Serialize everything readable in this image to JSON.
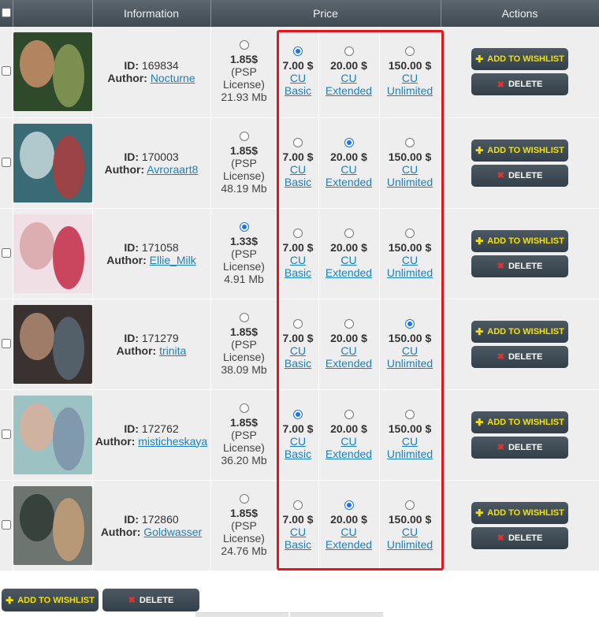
{
  "header": {
    "information": "Information",
    "price": "Price",
    "actions": "Actions"
  },
  "labels": {
    "id_prefix": "ID:",
    "author_prefix": "Author:",
    "psp_license": "(PSP License)",
    "cu": "CU",
    "basic": "Basic",
    "extended": "Extended",
    "unlimited": "Unlimited",
    "add_to_wishlist": "ADD TO WISHLIST",
    "delete": "DELETE"
  },
  "items": [
    {
      "id": "169834",
      "author": "Nocturne",
      "psp_price": "1.85$",
      "size": "21.93 Mb",
      "basic": "7.00 $",
      "extended": "20.00 $",
      "unlimited": "150.00 $",
      "selected": "basic",
      "thumb_colors": [
        "#2e4a2a",
        "#c98e6a",
        "#8fa05a"
      ]
    },
    {
      "id": "170003",
      "author": "Avroraart8",
      "psp_price": "1.85$",
      "size": "48.19 Mb",
      "basic": "7.00 $",
      "extended": "20.00 $",
      "unlimited": "150.00 $",
      "selected": "extended",
      "thumb_colors": [
        "#3a6b74",
        "#c7d8dc",
        "#b43a3a"
      ]
    },
    {
      "id": "171058",
      "author": "Ellie_Milk",
      "psp_price": "1.33$",
      "size": "4.91 Mb",
      "basic": "7.00 $",
      "extended": "20.00 $",
      "unlimited": "150.00 $",
      "selected": "psp",
      "thumb_colors": [
        "#f0dfe4",
        "#d9a6a8",
        "#c01f3c"
      ]
    },
    {
      "id": "171279",
      "author": "trinita",
      "psp_price": "1.85$",
      "size": "38.09 Mb",
      "basic": "7.00 $",
      "extended": "20.00 $",
      "unlimited": "150.00 $",
      "selected": "unlimited",
      "thumb_colors": [
        "#3a3230",
        "#b08a72",
        "#5a6a78"
      ]
    },
    {
      "id": "172762",
      "author": "misticheskaya",
      "psp_price": "1.85$",
      "size": "36.20 Mb",
      "basic": "7.00 $",
      "extended": "20.00 $",
      "unlimited": "150.00 $",
      "selected": "basic",
      "thumb_colors": [
        "#9cc2c4",
        "#d8b09a",
        "#7a8fa8"
      ]
    },
    {
      "id": "172860",
      "author": "Goldwasser",
      "psp_price": "1.85$",
      "size": "24.76 Mb",
      "basic": "7.00 $",
      "extended": "20.00 $",
      "unlimited": "150.00 $",
      "selected": "extended",
      "thumb_colors": [
        "#6e7470",
        "#2e3a34",
        "#c9a27a"
      ]
    }
  ],
  "colors": {
    "header_bg": "#4b565f",
    "row_bg": "#eeeeee",
    "link": "#1c7fc0",
    "wishlist_text": "#f5e100",
    "delete_icon": "#e23333",
    "highlight_box": "#e8141b",
    "radio_selected": "#1a73e8"
  },
  "icons": {
    "wishlist": "plus-icon",
    "delete": "x-icon"
  }
}
